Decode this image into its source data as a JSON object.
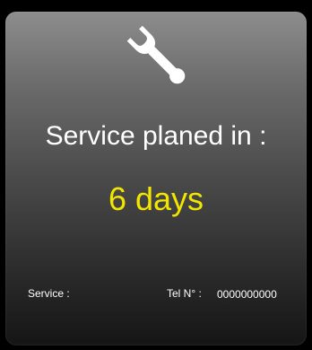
{
  "panel": {
    "icon": "wrench-icon",
    "headline": "Service planed in :",
    "countdown": "6 days",
    "countdown_color": "#f2e600",
    "footer": {
      "service_label": "Service :",
      "tel_label": "Tel N° :",
      "tel_value": "0000000000"
    }
  }
}
